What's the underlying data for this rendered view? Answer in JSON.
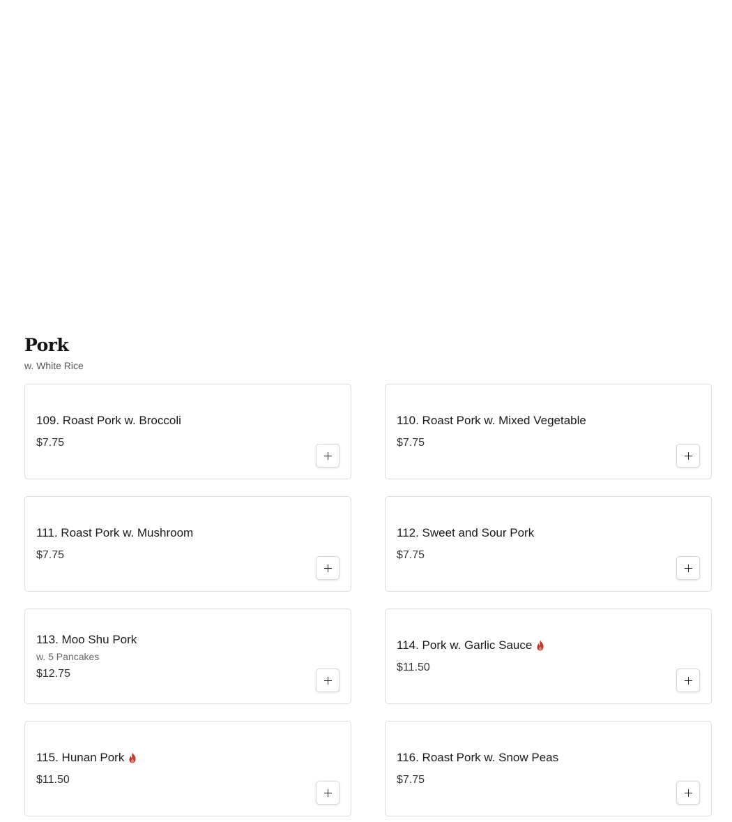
{
  "section": {
    "title": "Pork",
    "subtitle": "w. White Rice"
  },
  "items": [
    {
      "name": "109. Roast Pork w. Broccoli",
      "price": "$7.75",
      "desc": "",
      "spicy": false
    },
    {
      "name": "110. Roast Pork w. Mixed Vegetable",
      "price": "$7.75",
      "desc": "",
      "spicy": false
    },
    {
      "name": "111. Roast Pork w. Mushroom",
      "price": "$7.75",
      "desc": "",
      "spicy": false
    },
    {
      "name": "112. Sweet and Sour Pork",
      "price": "$7.75",
      "desc": "",
      "spicy": false
    },
    {
      "name": "113. Moo Shu Pork",
      "price": "$12.75",
      "desc": "w. 5 Pancakes",
      "spicy": false
    },
    {
      "name": "114. Pork w. Garlic Sauce",
      "price": "$11.50",
      "desc": "",
      "spicy": true
    },
    {
      "name": "115. Hunan Pork",
      "price": "$11.50",
      "desc": "",
      "spicy": true
    },
    {
      "name": "116. Roast Pork w. Snow Peas",
      "price": "$7.75",
      "desc": "",
      "spicy": false
    }
  ],
  "icons": {
    "add": "plus-icon",
    "spicy": "flame-icon"
  },
  "colors": {
    "spicy": "#c0392b",
    "border": "#dcdcdc"
  }
}
